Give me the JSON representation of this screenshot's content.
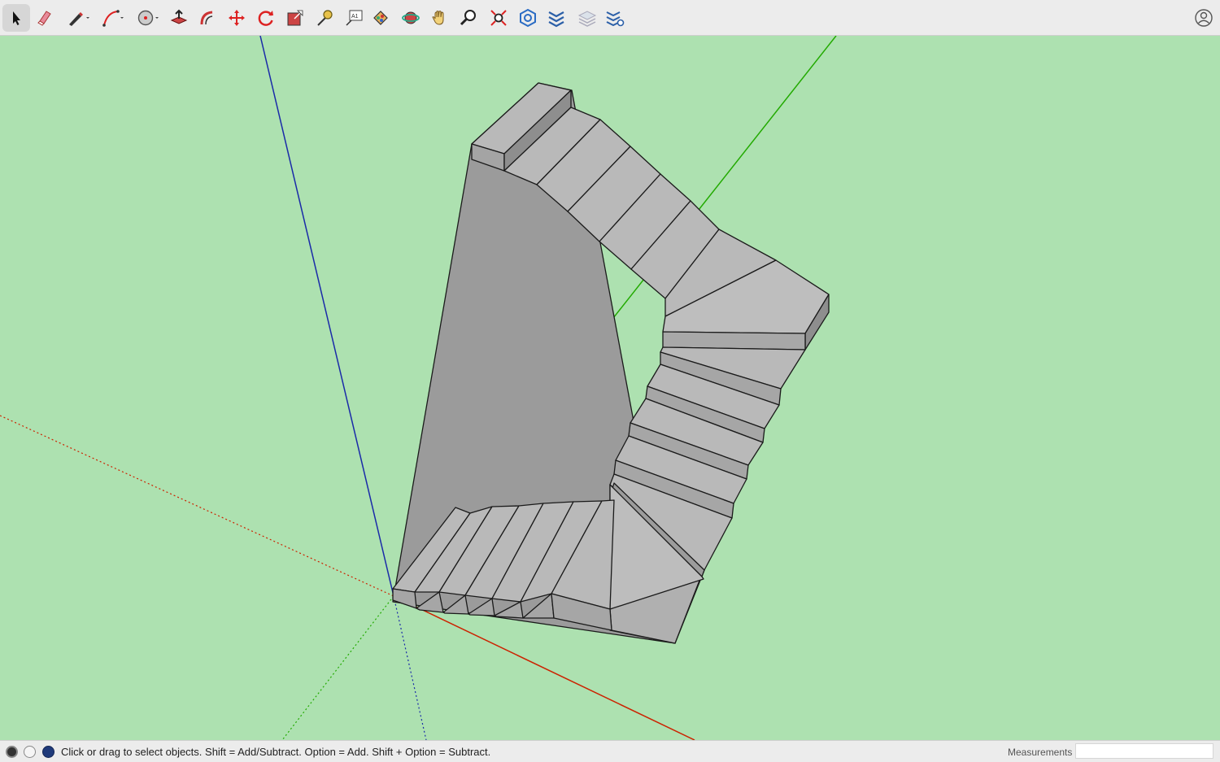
{
  "toolbar": {
    "tools": [
      {
        "name": "select-tool",
        "icon": "arrow-cursor-icon",
        "active": true
      },
      {
        "name": "eraser-tool",
        "icon": "eraser-icon"
      },
      {
        "name": "line-tool",
        "icon": "pencil-icon",
        "has_dropdown": true
      },
      {
        "name": "arc-tool",
        "icon": "arc-icon",
        "has_dropdown": true
      },
      {
        "name": "shape-tool",
        "icon": "circle-shape-icon",
        "has_dropdown": true
      },
      {
        "name": "push-pull-tool",
        "icon": "push-pull-icon"
      },
      {
        "name": "offset-tool",
        "icon": "offset-icon"
      },
      {
        "name": "move-tool",
        "icon": "move-arrows-icon"
      },
      {
        "name": "rotate-tool",
        "icon": "rotate-icon"
      },
      {
        "name": "scale-tool",
        "icon": "scale-icon"
      },
      {
        "name": "tape-measure-tool",
        "icon": "tape-measure-icon"
      },
      {
        "name": "text-tool",
        "icon": "text-label-icon"
      },
      {
        "name": "paint-bucket-tool",
        "icon": "paint-bucket-icon"
      },
      {
        "name": "orbit-tool",
        "icon": "orbit-icon"
      },
      {
        "name": "pan-tool",
        "icon": "hand-icon"
      },
      {
        "name": "zoom-tool",
        "icon": "magnifier-icon"
      },
      {
        "name": "zoom-extents-tool",
        "icon": "zoom-extents-icon"
      },
      {
        "name": "3d-warehouse-button",
        "icon": "warehouse-icon"
      },
      {
        "name": "extension-warehouse-button",
        "icon": "extension-warehouse-icon"
      },
      {
        "name": "layout-button",
        "icon": "layout-icon"
      },
      {
        "name": "extension-manager-button",
        "icon": "extension-manager-icon"
      }
    ],
    "account_icon": "user-account-icon"
  },
  "statusbar": {
    "message": "Click or drag to select objects. Shift = Add/Subtract. Option = Add. Shift + Option = Subtract.",
    "measurements_label": "Measurements",
    "measurements_value": ""
  },
  "colors": {
    "ground": "#ade1b0",
    "stair_face": "#b9b9b9",
    "axis_red": "#cc2200",
    "axis_green": "#22aa00",
    "axis_blue": "#1a2aa8"
  }
}
